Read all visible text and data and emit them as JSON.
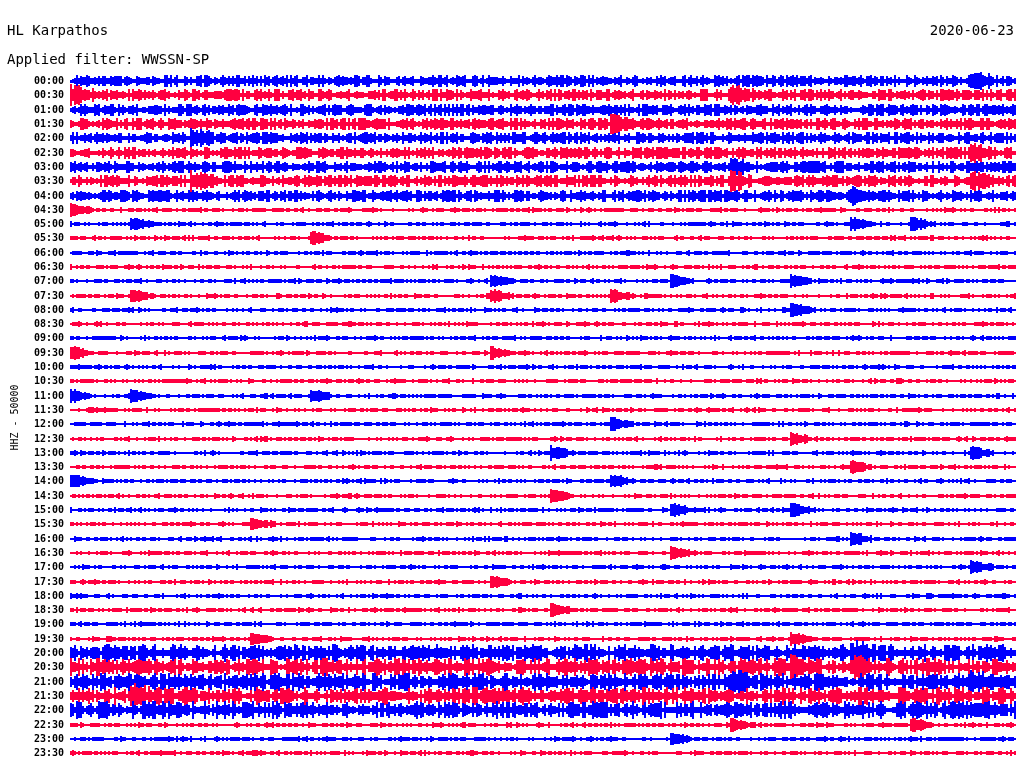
{
  "header": {
    "station": "HL Karpathos",
    "date": "2020-06-23",
    "filter": "Applied filter: WWSSN-SP"
  },
  "axis_label": "HHZ - 50000",
  "traces": [
    {
      "time": "00:00",
      "color": "#0000ff"
    },
    {
      "time": "00:30",
      "color": "#ff0040"
    },
    {
      "time": "01:00",
      "color": "#0000ff"
    },
    {
      "time": "01:30",
      "color": "#ff0040"
    },
    {
      "time": "02:00",
      "color": "#0000ff"
    },
    {
      "time": "02:30",
      "color": "#ff0040"
    },
    {
      "time": "03:00",
      "color": "#0000ff"
    },
    {
      "time": "03:30",
      "color": "#ff0040"
    },
    {
      "time": "04:00",
      "color": "#0000ff"
    },
    {
      "time": "04:30",
      "color": "#ff0040"
    },
    {
      "time": "05:00",
      "color": "#0000ff"
    },
    {
      "time": "05:30",
      "color": "#ff0040"
    },
    {
      "time": "06:00",
      "color": "#0000ff"
    },
    {
      "time": "06:30",
      "color": "#ff0040"
    },
    {
      "time": "07:00",
      "color": "#0000ff"
    },
    {
      "time": "07:30",
      "color": "#ff0040"
    },
    {
      "time": "08:00",
      "color": "#0000ff"
    },
    {
      "time": "08:30",
      "color": "#ff0040"
    },
    {
      "time": "09:00",
      "color": "#0000ff"
    },
    {
      "time": "09:30",
      "color": "#ff0040"
    },
    {
      "time": "10:00",
      "color": "#0000ff"
    },
    {
      "time": "10:30",
      "color": "#ff0040"
    },
    {
      "time": "11:00",
      "color": "#0000ff"
    },
    {
      "time": "11:30",
      "color": "#ff0040"
    },
    {
      "time": "12:00",
      "color": "#0000ff"
    },
    {
      "time": "12:30",
      "color": "#ff0040"
    },
    {
      "time": "13:00",
      "color": "#0000ff"
    },
    {
      "time": "13:30",
      "color": "#ff0040"
    },
    {
      "time": "14:00",
      "color": "#0000ff"
    },
    {
      "time": "14:30",
      "color": "#ff0040"
    },
    {
      "time": "15:00",
      "color": "#0000ff"
    },
    {
      "time": "15:30",
      "color": "#ff0040"
    },
    {
      "time": "16:00",
      "color": "#0000ff"
    },
    {
      "time": "16:30",
      "color": "#ff0040"
    },
    {
      "time": "17:00",
      "color": "#0000ff"
    },
    {
      "time": "17:30",
      "color": "#ff0040"
    },
    {
      "time": "18:00",
      "color": "#0000ff"
    },
    {
      "time": "18:30",
      "color": "#ff0040"
    },
    {
      "time": "19:00",
      "color": "#0000ff"
    },
    {
      "time": "19:30",
      "color": "#ff0040"
    },
    {
      "time": "20:00",
      "color": "#0000ff"
    },
    {
      "time": "20:30",
      "color": "#ff0040"
    },
    {
      "time": "21:00",
      "color": "#0000ff"
    },
    {
      "time": "21:30",
      "color": "#ff0040"
    },
    {
      "time": "22:00",
      "color": "#0000ff"
    },
    {
      "time": "22:30",
      "color": "#ff0040"
    },
    {
      "time": "23:00",
      "color": "#0000ff"
    },
    {
      "time": "23:30",
      "color": "#ff0040"
    }
  ]
}
